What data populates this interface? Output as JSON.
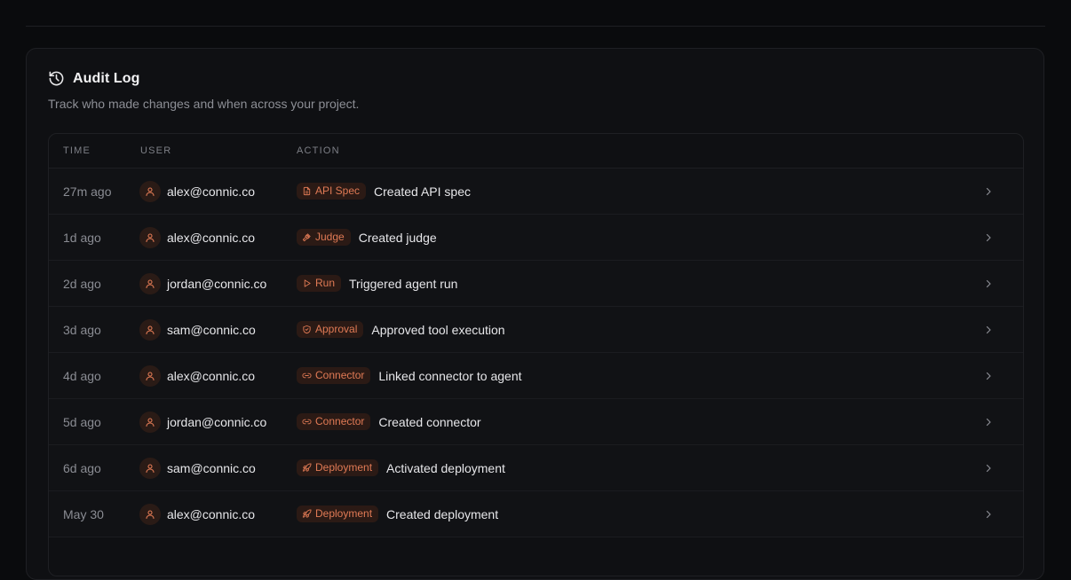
{
  "card": {
    "title": "Audit Log",
    "subtitle": "Track who made changes and when across your project."
  },
  "table": {
    "headers": {
      "time": "TIME",
      "user": "USER",
      "action": "ACTION"
    },
    "rows": [
      {
        "time": "27m ago",
        "user": "alex@connic.co",
        "badge": "API Spec",
        "badge_icon": "file-icon",
        "action": "Created API spec"
      },
      {
        "time": "1d ago",
        "user": "alex@connic.co",
        "badge": "Judge",
        "badge_icon": "gavel-icon",
        "action": "Created judge"
      },
      {
        "time": "2d ago",
        "user": "jordan@connic.co",
        "badge": "Run",
        "badge_icon": "play-icon",
        "action": "Triggered agent run"
      },
      {
        "time": "3d ago",
        "user": "sam@connic.co",
        "badge": "Approval",
        "badge_icon": "shield-check-icon",
        "action": "Approved tool execution"
      },
      {
        "time": "4d ago",
        "user": "alex@connic.co",
        "badge": "Connector",
        "badge_icon": "link-icon",
        "action": "Linked connector to agent"
      },
      {
        "time": "5d ago",
        "user": "jordan@connic.co",
        "badge": "Connector",
        "badge_icon": "link-icon",
        "action": "Created connector"
      },
      {
        "time": "6d ago",
        "user": "sam@connic.co",
        "badge": "Deployment",
        "badge_icon": "rocket-icon",
        "action": "Activated deployment"
      },
      {
        "time": "May 30",
        "user": "alex@connic.co",
        "badge": "Deployment",
        "badge_icon": "rocket-icon",
        "action": "Created deployment"
      }
    ]
  },
  "colors": {
    "accent": "#e07a55",
    "badge_bg": "#2b1a15",
    "avatar_bg": "#2a1b16",
    "background": "#0a0b0d",
    "card_bg": "#0f1013"
  }
}
